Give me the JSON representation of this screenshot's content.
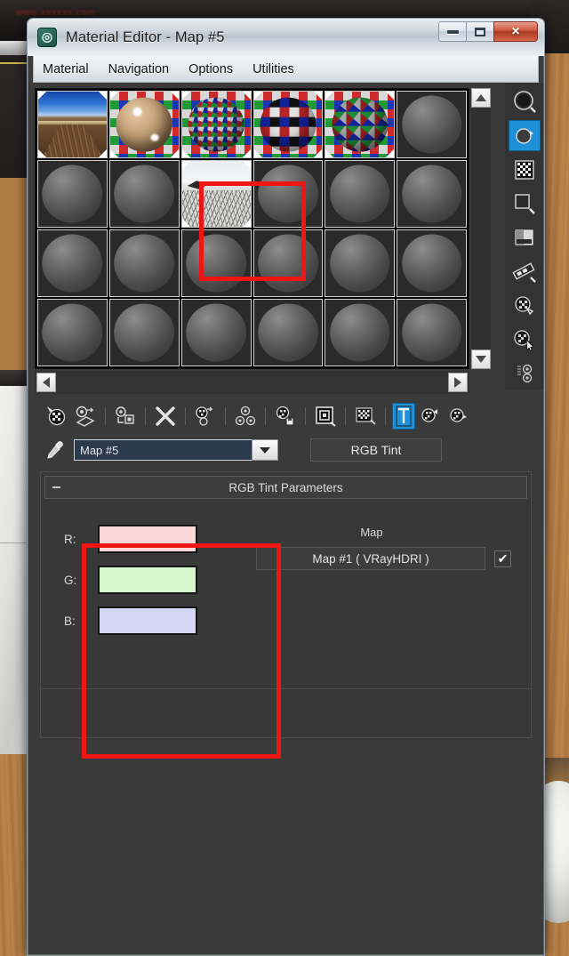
{
  "desktop": {
    "watermark": "www.xxxxxx.com"
  },
  "window": {
    "title": "Material Editor - Map #5",
    "app_icon": "max-logo-icon",
    "buttons": {
      "minimize": "minimize-icon",
      "maximize": "maximize-icon",
      "close": "×"
    }
  },
  "menubar": {
    "items": [
      {
        "label": "Material"
      },
      {
        "label": "Navigation"
      },
      {
        "label": "Options"
      },
      {
        "label": "Utilities"
      }
    ]
  },
  "slots": {
    "rows": 4,
    "columns": 6,
    "active_index": 8,
    "items": [
      {
        "name": "slot-1",
        "kind": "road-hdri",
        "active": true
      },
      {
        "name": "slot-2",
        "kind": "tan-ball",
        "active": true
      },
      {
        "name": "slot-3",
        "kind": "checker-ball",
        "active": true
      },
      {
        "name": "slot-4",
        "kind": "checker-ball2",
        "active": true
      },
      {
        "name": "slot-5",
        "kind": "checker-ball3",
        "active": true
      },
      {
        "name": "slot-6",
        "kind": "gray-ball",
        "active": false
      },
      {
        "name": "slot-7",
        "kind": "gray-ball",
        "active": false
      },
      {
        "name": "slot-8",
        "kind": "gray-ball",
        "active": false
      },
      {
        "name": "slot-9",
        "kind": "hdri-snow",
        "active": true
      },
      {
        "name": "slot-10",
        "kind": "gray-ball",
        "active": false
      },
      {
        "name": "slot-11",
        "kind": "gray-ball",
        "active": false
      },
      {
        "name": "slot-12",
        "kind": "gray-ball",
        "active": false
      },
      {
        "name": "slot-13",
        "kind": "gray-ball",
        "active": false
      },
      {
        "name": "slot-14",
        "kind": "gray-ball",
        "active": false
      },
      {
        "name": "slot-15",
        "kind": "gray-ball",
        "active": false
      },
      {
        "name": "slot-16",
        "kind": "gray-ball",
        "active": false
      },
      {
        "name": "slot-17",
        "kind": "gray-ball",
        "active": false
      },
      {
        "name": "slot-18",
        "kind": "gray-ball",
        "active": false
      },
      {
        "name": "slot-19",
        "kind": "gray-ball",
        "active": false
      },
      {
        "name": "slot-20",
        "kind": "gray-ball",
        "active": false
      },
      {
        "name": "slot-21",
        "kind": "gray-ball",
        "active": false
      },
      {
        "name": "slot-22",
        "kind": "gray-ball",
        "active": false
      },
      {
        "name": "slot-23",
        "kind": "gray-ball",
        "active": false
      },
      {
        "name": "slot-24",
        "kind": "gray-ball",
        "active": false
      }
    ]
  },
  "vertical_toolbar": {
    "items": [
      {
        "name": "sample-type-sphere-icon",
        "selected": false
      },
      {
        "name": "backlight-icon",
        "selected": true
      },
      {
        "name": "background-checker-icon",
        "selected": false
      },
      {
        "name": "sample-uv-tiling-icon",
        "selected": false
      },
      {
        "name": "video-color-check-icon",
        "selected": false
      },
      {
        "name": "make-preview-icon",
        "selected": false
      },
      {
        "name": "options-icon",
        "selected": false
      },
      {
        "name": "select-by-material-icon",
        "selected": false
      },
      {
        "name": "material-id-channel-icon",
        "selected": false
      }
    ]
  },
  "slot_scroll": {
    "up": "scroll-up-arrow",
    "down": "scroll-down-arrow",
    "left": "scroll-left-arrow",
    "right": "scroll-right-arrow"
  },
  "icon_toolbar": {
    "items": [
      {
        "name": "get-material-icon"
      },
      {
        "name": "put-material-to-scene-icon"
      },
      {
        "name": "assign-material-to-selection-icon"
      },
      {
        "name": "reset-map-material-icon"
      },
      {
        "name": "make-material-copy-icon"
      },
      {
        "name": "make-unique-icon"
      },
      {
        "name": "put-to-library-icon"
      },
      {
        "name": "material-effects-channel-icon"
      },
      {
        "name": "show-map-in-viewport-icon"
      },
      {
        "name": "show-end-result-icon",
        "selected": true
      },
      {
        "name": "go-to-parent-icon"
      },
      {
        "name": "go-forward-to-sibling-icon"
      }
    ]
  },
  "name_row": {
    "eyedropper_icon": "eyedropper-icon",
    "material_name": "Map #5",
    "dropdown_icon": "chevron-down-icon",
    "type_button": "RGB Tint"
  },
  "rollout": {
    "collapse_icon": "-",
    "title": "RGB Tint Parameters",
    "channels": [
      {
        "label": "R:",
        "color": "#fcd7d7"
      },
      {
        "label": "G:",
        "color": "#d6f6cd"
      },
      {
        "label": "B:",
        "color": "#d6d6f7"
      }
    ],
    "map": {
      "caption": "Map",
      "button_label": "Map #1 ( VRayHDRI )",
      "checkbox_checked": true,
      "check_glyph": "✔"
    }
  },
  "annotations": [
    {
      "name": "highlight-active-slot",
      "color": "#ef1515"
    },
    {
      "name": "highlight-rgb-channels",
      "color": "#ef1515"
    }
  ]
}
